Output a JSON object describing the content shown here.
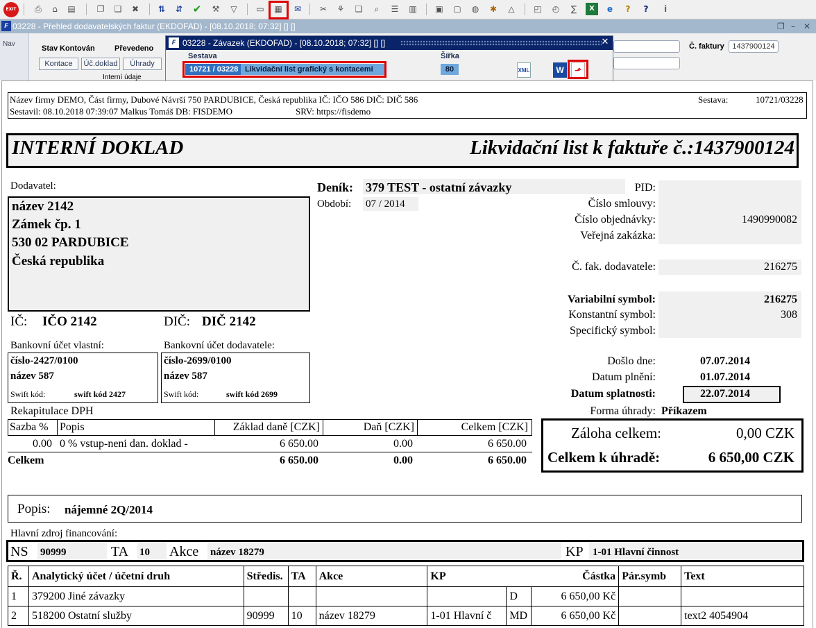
{
  "toolbar": {
    "exit_label": "EXIT",
    "buttons": [
      "print-preview",
      "home",
      "print-setup",
      "copy",
      "paste",
      "delete",
      "sort-ascending",
      "sort-descending",
      "confirm",
      "tools",
      "filter",
      "report",
      "print-reports",
      "email",
      "cut",
      "tree",
      "book",
      "binoculars",
      "list",
      "columns",
      "export",
      "save",
      "globe",
      "settings",
      "triangle",
      "chart",
      "graph",
      "sum",
      "excel",
      "internet",
      "help",
      "question",
      "info"
    ]
  },
  "window": {
    "title": "03228 - Přehled dodavatelských faktur (EKDOFAD) - [08.10.2018; 07:32]  []  []"
  },
  "background_form": {
    "nav": "Nav",
    "stav_label": "Stav",
    "stav_value": "Kontován",
    "prevedeno": "Převedeno",
    "tabs": [
      "Kontace",
      "Úč.doklad",
      "Úhrady"
    ],
    "interni_udaje": "Interní údaje",
    "faktura_label": "Č. faktury",
    "faktura_value": "1437900124"
  },
  "dialog": {
    "title": "03228 - Závazek (EKDOFAD) - [08.10.2018; 07:32]  []  []",
    "sestava_label": "Sestava",
    "sirka_label": "Šířka",
    "code": "10721 / 03228",
    "name": "Likvidační list grafický s kontacemi",
    "width": "80",
    "export_icons": [
      "xml-export-icon",
      "word-export-icon",
      "pdf-export-icon"
    ]
  },
  "report": {
    "company_line": "Název firmy DEMO, Část firmy, Dubové Návrší 750 PARDUBICE, Česká republika  IČ: IČO 586  DIČ: DIČ 586",
    "sestava_label": "Sestava:",
    "sestava_value": "10721/03228",
    "created_line": "Sestavil: 08.10.2018 07:39:07 Malkus Tomáš  DB: FISDEMO",
    "srv_line": "SRV: https://fisdemo",
    "title_left": "INTERNÍ DOKLAD",
    "title_right": "Likvidační list k faktuře č.:1437900124",
    "dodavatel_label": "Dodavatel:",
    "dodavatel_lines": [
      "název 2142",
      "Zámek čp. 1",
      "530 02 PARDUBICE",
      "Česká republika"
    ],
    "ic_label": "IČ:",
    "ic_value": "IČO 2142",
    "dic_label": "DIČ:",
    "dic_value": "DIČ 2142",
    "bank_own_label": "Bankovní účet vlastní:",
    "bank_own": {
      "number": "číslo-2427/0100",
      "name": "název 587",
      "swift_label": "Swift kód:",
      "swift": "swift kód 2427"
    },
    "bank_supplier_label": "Bankovní účet dodavatele:",
    "bank_supplier": {
      "number": "číslo-2699/0100",
      "name": "název 587",
      "swift_label": "Swift kód:",
      "swift": "swift kód 2699"
    },
    "denik_label": "Deník:",
    "denik_value": "379 TEST - ostatní závazky",
    "obdobi_label": "Období:",
    "obdobi_value": "07 / 2014",
    "pid_label": "PID:",
    "pid_value": "",
    "smlouva_label": "Číslo smlouvy:",
    "smlouva_value": "",
    "objednavka_label": "Číslo objednávky:",
    "objednavka_value": "1490990082",
    "zakazka_label": "Veřejná zakázka:",
    "zakazka_value": "",
    "fak_dod_label": "Č. fak. dodavatele:",
    "fak_dod_value": "216275",
    "var_label": "Variabilní symbol:",
    "var_value": "216275",
    "konst_label": "Konstantní symbol:",
    "konst_value": "308",
    "spec_label": "Specifický symbol:",
    "spec_value": "",
    "doslo_label": "Došlo dne:",
    "doslo_value": "07.07.2014",
    "plneni_label": "Datum plnění:",
    "plneni_value": "01.07.2014",
    "splatnost_label": "Datum splatnosti:",
    "splatnost_value": "22.07.2014",
    "forma_label": "Forma úhrady:",
    "forma_value": "Příkazem",
    "dph_label": "Rekapitulace DPH",
    "dph_headers": [
      "Sazba %",
      "Popis",
      "Základ daně [CZK]",
      "Daň [CZK]",
      "Celkem [CZK]"
    ],
    "dph_row": [
      "0.00",
      "0 % vstup-neni dan. doklad -",
      "6 650.00",
      "0.00",
      "6 650.00"
    ],
    "dph_total": [
      "Celkem",
      "6 650.00",
      "0.00",
      "6 650.00"
    ],
    "zaloha_label": "Záloha celkem:",
    "zaloha_value": "0,00 CZK",
    "uhrada_label": "Celkem k úhradě:",
    "uhrada_value": "6 650,00 CZK",
    "popis_label": "Popis:",
    "popis_value": "nájemné 2Q/2014",
    "zdroj_label": "Hlavní zdroj financování:",
    "ns_label": "NS",
    "ns_value": "90999",
    "ta_label": "TA",
    "ta_value": "10",
    "akce_label": "Akce",
    "akce_value": "název 18279",
    "kp_label": "KP",
    "kp_value": "1-01 Hlavní činnost",
    "acc_headers": [
      "Ř.",
      "Analytický účet / účetní druh",
      "Středis.",
      "TA",
      "Akce",
      "KP",
      "",
      "Částka",
      "Pár.symb",
      "Text"
    ],
    "acc_rows": [
      [
        "1",
        "379200 Jiné závazky",
        "",
        "",
        "",
        "",
        "D",
        "6 650,00 Kč",
        "",
        ""
      ],
      [
        "2",
        "518200 Ostatní služby",
        "90999",
        "10",
        "název 18279",
        "1-01 Hlavní č",
        "MD",
        "6 650,00 Kč",
        "",
        "text2 4054904"
      ]
    ]
  }
}
